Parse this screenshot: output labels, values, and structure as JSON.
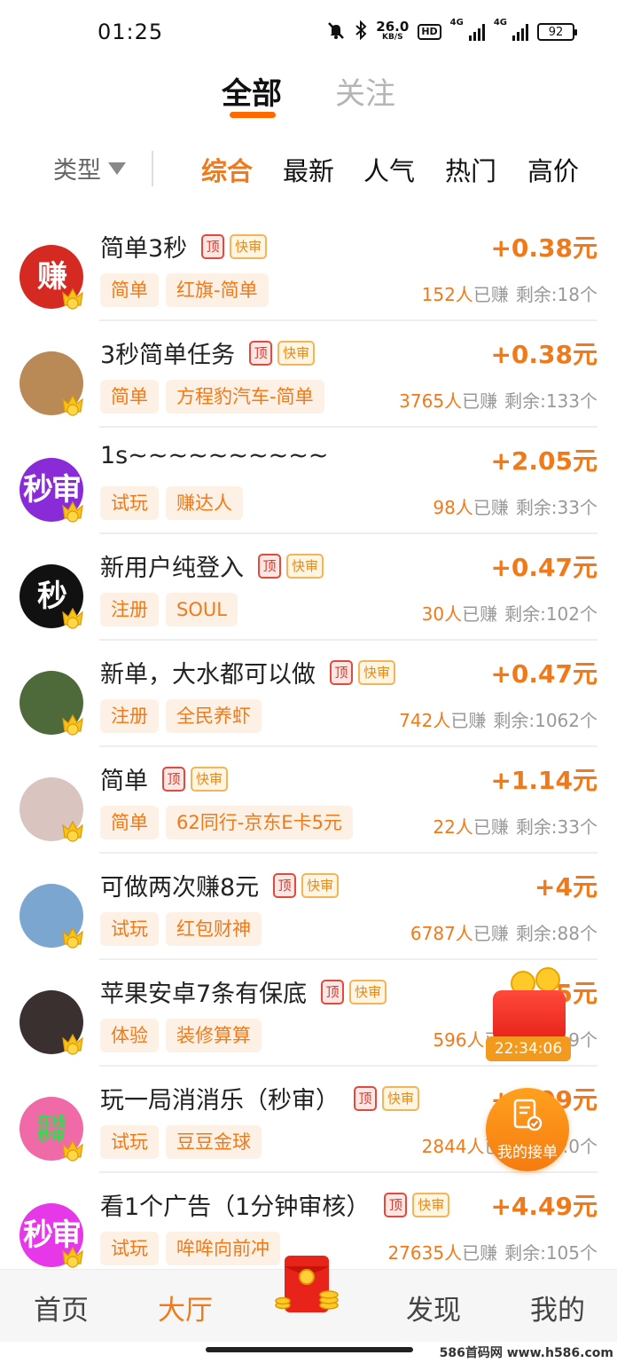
{
  "status_bar": {
    "time": "01:25",
    "speed_value": "26.0",
    "speed_unit": "KB/S",
    "hd": "HD",
    "net1": "4G",
    "net2": "4G",
    "battery": "92"
  },
  "top_tabs": {
    "all": "全部",
    "follow": "关注"
  },
  "filter": {
    "type_label": "类型",
    "sort_options": [
      "综合",
      "最新",
      "人气",
      "热门",
      "高价"
    ]
  },
  "badges": {
    "top": "顶",
    "fast": "快审"
  },
  "tasks": [
    {
      "title": "简单3秒",
      "tags": [
        "简单",
        "红旗-简单"
      ],
      "price": "+0.38元",
      "count": "152人",
      "earned": "已赚",
      "remaining": "剩余:18个",
      "avatar_text": "赚",
      "avatar_color": "#d42a22",
      "top": true,
      "fast": true
    },
    {
      "title": "3秒简单任务",
      "tags": [
        "简单",
        "方程豹汽车-简单"
      ],
      "price": "+0.38元",
      "count": "3765人",
      "earned": "已赚",
      "remaining": "剩余:133个",
      "avatar_text": "",
      "avatar_color": "#b98a55",
      "top": true,
      "fast": true
    },
    {
      "title": "1s~~~~~~~~~~",
      "tags": [
        "试玩",
        "赚达人"
      ],
      "price": "+2.05元",
      "count": "98人",
      "earned": "已赚",
      "remaining": "剩余:33个",
      "avatar_text": "秒审",
      "avatar_color": "#8a2bd8",
      "top": false,
      "fast": false
    },
    {
      "title": "新用户纯登入",
      "tags": [
        "注册",
        "SOUL"
      ],
      "price": "+0.47元",
      "count": "30人",
      "earned": "已赚",
      "remaining": "剩余:102个",
      "avatar_text": "秒",
      "avatar_color": "#111111",
      "top": true,
      "fast": true
    },
    {
      "title": "新单，大水都可以做",
      "tags": [
        "注册",
        "全民养虾"
      ],
      "price": "+0.47元",
      "count": "742人",
      "earned": "已赚",
      "remaining": "剩余:1062个",
      "avatar_text": "",
      "avatar_color": "#4f6a3a",
      "top": true,
      "fast": true
    },
    {
      "title": "简单",
      "tags": [
        "简单",
        "62同行-京东E卡5元"
      ],
      "price": "+1.14元",
      "count": "22人",
      "earned": "已赚",
      "remaining": "剩余:33个",
      "avatar_text": "",
      "avatar_color": "#d9c4c0",
      "top": true,
      "fast": true
    },
    {
      "title": "可做两次赚8元",
      "tags": [
        "试玩",
        "红包财神"
      ],
      "price": "+4元",
      "count": "6787人",
      "earned": "已赚",
      "remaining": "剩余:88个",
      "avatar_text": "",
      "avatar_color": "#7aa6cf",
      "top": true,
      "fast": true
    },
    {
      "title": "苹果安卓7条有保底",
      "tags": [
        "体验",
        "装修算算"
      ],
      "price": "+5元",
      "count": "596人",
      "earned": "已赚",
      "remaining": "剩余:9个",
      "avatar_text": "",
      "avatar_color": "#3a3030",
      "top": true,
      "fast": true
    },
    {
      "title": "玩一局消消乐（秒审）",
      "tags": [
        "试玩",
        "豆豆金球"
      ],
      "price": "+5.09元",
      "count": "2844人",
      "earned": "已赚",
      "remaining": "剩余:0个",
      "avatar_text": "在线秒审",
      "avatar_color": "#f06aa8",
      "top": true,
      "fast": true
    },
    {
      "title": "看1个广告（1分钟审核）",
      "tags": [
        "试玩",
        "哞哞向前冲"
      ],
      "price": "+4.49元",
      "count": "27635人",
      "earned": "已赚",
      "remaining": "剩余:105个",
      "avatar_text": "秒审",
      "avatar_color": "#e637e8",
      "top": true,
      "fast": true
    }
  ],
  "float": {
    "timer": "22:34:06",
    "my_orders": "我的接单"
  },
  "bottom_nav": {
    "home": "首页",
    "hall": "大厅",
    "discover": "发现",
    "mine": "我的"
  },
  "watermark": "586首码网 www.h586.com",
  "colors": {
    "accent": "#f07a1a",
    "top_badge": "#e24a3e",
    "fast_badge": "#f3b45a"
  }
}
